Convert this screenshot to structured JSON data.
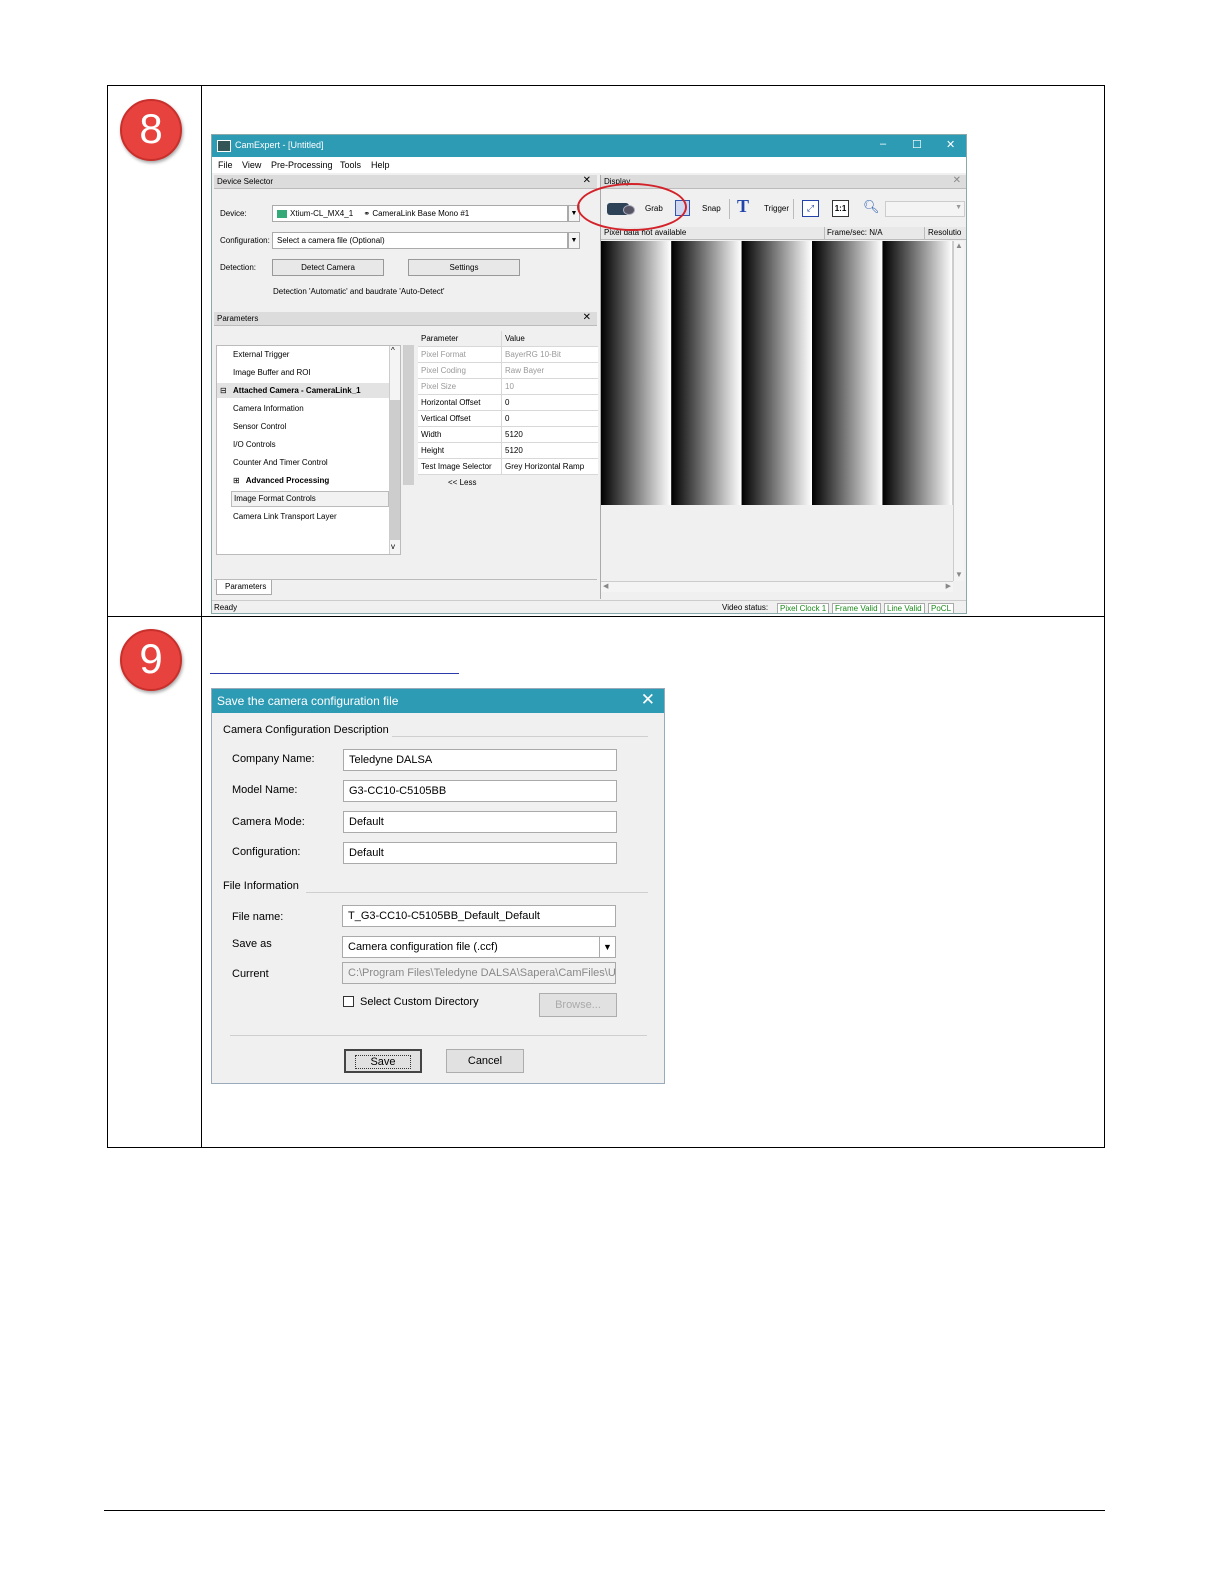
{
  "steps": [
    {
      "number": "8"
    },
    {
      "number": "9"
    }
  ],
  "camexpert": {
    "title": "CamExpert - [Untitled]",
    "window_buttons": [
      "–",
      "☐",
      "✕"
    ],
    "menu": [
      "File",
      "View",
      "Pre-Processing",
      "Tools",
      "Help"
    ],
    "device_selector": {
      "header": "Device Selector",
      "device_label": "Device:",
      "device_value": "Xtium-CL_MX4_1",
      "device_camera": "CameraLink Base Mono #1",
      "configuration_label": "Configuration:",
      "configuration_value": "Select a camera file (Optional)",
      "detection_label": "Detection:",
      "detect_button": "Detect Camera",
      "settings_button": "Settings",
      "detection_note": "Detection 'Automatic' and baudrate 'Auto-Detect'"
    },
    "parameters": {
      "header": "Parameters",
      "tree": [
        {
          "label": "External Trigger"
        },
        {
          "label": "Image Buffer and ROI"
        },
        {
          "label": "Attached Camera - CameraLink_1",
          "toggle": "⊟"
        },
        {
          "label": "Camera Information"
        },
        {
          "label": "Sensor Control"
        },
        {
          "label": "I/O Controls"
        },
        {
          "label": "Counter And Timer Control"
        },
        {
          "label": "Advanced Processing",
          "toggle": "⊞"
        },
        {
          "label": "Image Format Controls"
        },
        {
          "label": "Camera Link Transport Layer"
        }
      ],
      "table_headers": [
        "Parameter",
        "Value"
      ],
      "rows": [
        {
          "param": "Pixel Format",
          "value": "BayerRG 10-Bit"
        },
        {
          "param": "Pixel Coding",
          "value": "Raw Bayer"
        },
        {
          "param": "Pixel Size",
          "value": "10"
        },
        {
          "param": "Horizontal Offset",
          "value": "0"
        },
        {
          "param": "Vertical Offset",
          "value": "0"
        },
        {
          "param": "Width",
          "value": "5120"
        },
        {
          "param": "Height",
          "value": "5120"
        },
        {
          "param": "Test Image Selector",
          "value": "Grey Horizontal Ramp"
        }
      ],
      "less_link": "<< Less",
      "tab": "Parameters"
    },
    "display": {
      "header": "Display",
      "grab": "Grab",
      "snap": "Snap",
      "trigger": "Trigger",
      "one_to_one": "1:1",
      "pixel_data": "Pixel data not available",
      "frame_rate": "Frame/sec: N/A",
      "resolution": "Resolutio"
    },
    "status": {
      "ready": "Ready",
      "video_status": "Video status:",
      "pixel_clock": "Pixel Clock 1",
      "frame_valid": "Frame Valid",
      "line_valid": "Line Valid",
      "pocl": "PoCL"
    }
  },
  "save_dialog": {
    "title": "Save the camera configuration file",
    "close": "✕",
    "desc_group": "Camera Configuration Description",
    "company_label": "Company Name:",
    "company_value": "Teledyne DALSA",
    "model_label": "Model Name:",
    "model_value": "G3-CC10-C5105BB",
    "mode_label": "Camera Mode:",
    "mode_value": "Default",
    "config_label": "Configuration:",
    "config_value": "Default",
    "file_group": "File Information",
    "filename_label": "File name:",
    "filename_value": "T_G3-CC10-C5105BB_Default_Default",
    "saveas_label": "Save as",
    "saveas_value": "Camera configuration file (.ccf)",
    "current_label": "Current",
    "current_value": "C:\\Program Files\\Teledyne DALSA\\Sapera\\CamFiles\\U",
    "custom_dir_label": "Select Custom Directory",
    "browse_button": "Browse...",
    "save_button": "Save",
    "cancel_button": "Cancel"
  }
}
